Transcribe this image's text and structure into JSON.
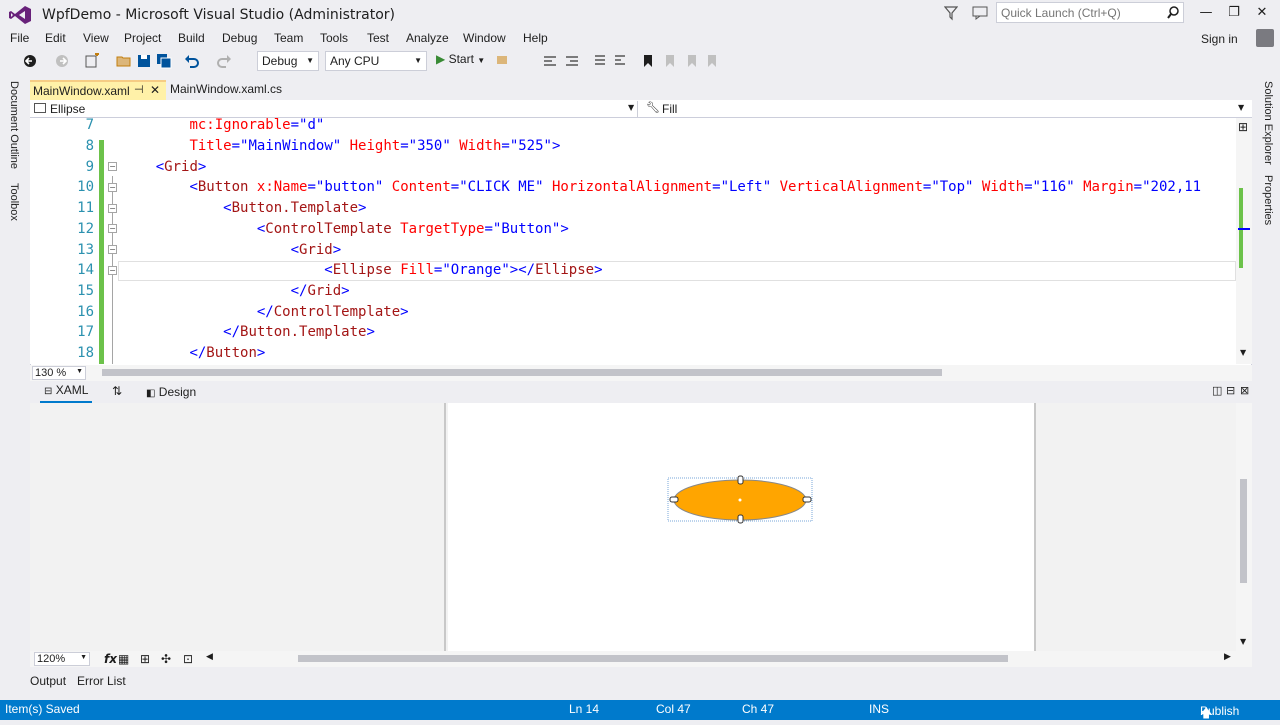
{
  "window": {
    "title": "WpfDemo - Microsoft Visual Studio (Administrator)",
    "quick_launch_placeholder": "Quick Launch (Ctrl+Q)",
    "minimize": "—",
    "restore": "❐",
    "close": "✕",
    "sign_in": "Sign in"
  },
  "menu": [
    "File",
    "Edit",
    "View",
    "Project",
    "Build",
    "Debug",
    "Team",
    "Tools",
    "Test",
    "Analyze",
    "Window",
    "Help"
  ],
  "toolbar": {
    "config": "Debug",
    "platform": "Any CPU",
    "start": "Start"
  },
  "side_tabs": {
    "left": [
      "Document Outline",
      "Toolbox"
    ],
    "right": [
      "Solution Explorer",
      "Properties"
    ]
  },
  "tabs": [
    {
      "label": "MainWindow.xaml",
      "active": true
    },
    {
      "label": "MainWindow.xaml.cs",
      "active": false
    }
  ],
  "nav": {
    "element": "Ellipse",
    "property": "Fill"
  },
  "code": {
    "line_numbers": [
      "7",
      "8",
      "9",
      "10",
      "11",
      "12",
      "13",
      "14",
      "15",
      "16",
      "17",
      "18"
    ],
    "lines": [
      "        mc:Ignorable=\"d\"",
      "        Title=\"MainWindow\" Height=\"350\" Width=\"525\">",
      "    <Grid>",
      "        <Button x:Name=\"button\" Content=\"CLICK ME\" HorizontalAlignment=\"Left\" VerticalAlignment=\"Top\" Width=\"116\" Margin=\"202,11",
      "            <Button.Template>",
      "                <ControlTemplate TargetType=\"Button\">",
      "                    <Grid>",
      "                        <Ellipse Fill=\"Orange\"></Ellipse>",
      "                    </Grid>",
      "                </ControlTemplate>",
      "            </Button.Template>",
      "        </Button>"
    ]
  },
  "editor_zoom": "130 %",
  "split": {
    "xaml_tab": "XAML",
    "design_tab": "Design"
  },
  "designer": {
    "zoom": "120%",
    "ellipse_color": "#ffa500"
  },
  "bottom_tabs": [
    "Output",
    "Error List"
  ],
  "status": {
    "message": "Item(s) Saved",
    "line": "Ln 14",
    "col": "Col 47",
    "ch": "Ch 47",
    "mode": "INS",
    "publish": "Publish"
  },
  "colors": {
    "accent": "#007acc",
    "active_tab": "#fff1a8",
    "vs_purple": "#68217a"
  }
}
